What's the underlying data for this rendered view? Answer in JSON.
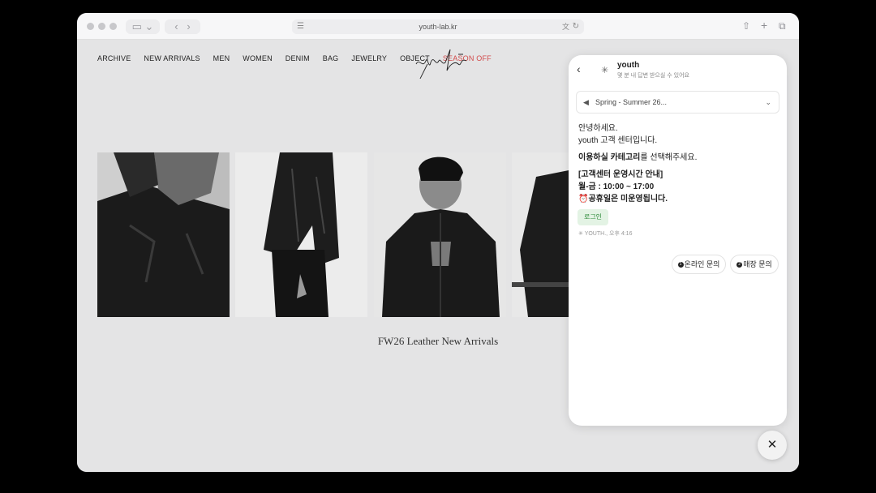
{
  "browser": {
    "url": "youth-lab.kr",
    "icons": [
      "sidebar-icon",
      "chevron-down-icon",
      "back-icon",
      "forward-icon",
      "page-icon",
      "translate-icon",
      "reload-icon",
      "share-icon",
      "plus-icon",
      "tabs-icon"
    ]
  },
  "site": {
    "nav": [
      "ARCHIVE",
      "NEW ARRIVALS",
      "MEN",
      "WOMEN",
      "DENIM",
      "BAG",
      "JEWELRY",
      "OBJECT",
      "SEASON OFF"
    ],
    "logo": "youth",
    "caption": "FW26 Leather New Arrivals"
  },
  "chat": {
    "title": "youth",
    "subtitle": "몇 분 내 답변 받으실 수 있어요",
    "notice": "Spring - Summer 26...",
    "greeting1": "안녕하세요.",
    "greeting2": "youth 고객 센터입니다.",
    "select_bold": "이용하실 카테고리",
    "select_rest": "를 선택해주세요.",
    "hours_title": "[고객센터 운영시간 안내]",
    "hours": "월-금 : 10:00 ~ 17:00",
    "holiday": "⏰공휴일은 미운영됩니다.",
    "login_label": "로그인",
    "meta": "YOUTH., 오후 4:16",
    "options": [
      {
        "num": "1",
        "label": "온라인 문의"
      },
      {
        "num": "2",
        "label": "매장 문의"
      }
    ],
    "close_label": "✕"
  },
  "colors": {
    "accent_green": "#2e8b3a",
    "sale_red": "#d24b4b"
  }
}
